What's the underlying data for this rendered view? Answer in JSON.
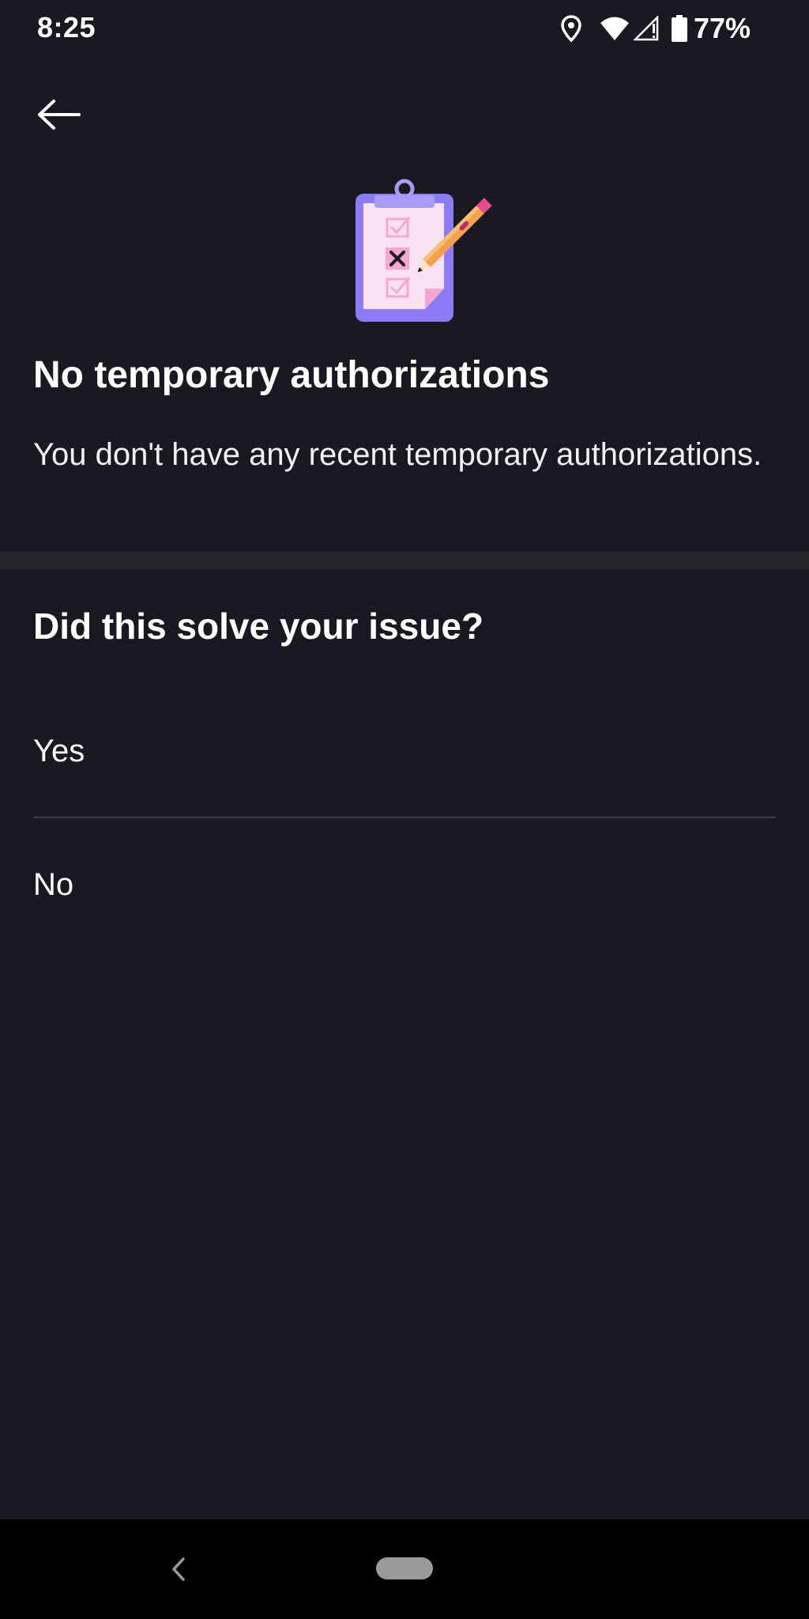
{
  "status_bar": {
    "time": "8:25",
    "battery_percent": "77%",
    "icons": [
      "location-icon",
      "wifi-icon",
      "signal-icon",
      "battery-icon"
    ]
  },
  "header": {
    "back_icon": "arrow-left-icon"
  },
  "empty_state": {
    "illustration": "clipboard-checklist-pencil-illustration",
    "title": "No temporary authorizations",
    "message": "You don't have any recent temporary authorizations."
  },
  "feedback": {
    "question": "Did this solve your issue?",
    "options": [
      {
        "label": "Yes"
      },
      {
        "label": "No"
      }
    ]
  },
  "nav_bar": {
    "back_icon": "chevron-left-icon",
    "home_icon": "home-pill-icon"
  },
  "colors": {
    "background": "#181921",
    "divider": "#26272d",
    "text": "#ffffff",
    "illustration_purple": "#8b7cf6",
    "illustration_pink": "#f9b3d4",
    "illustration_orange": "#f4a04c"
  }
}
